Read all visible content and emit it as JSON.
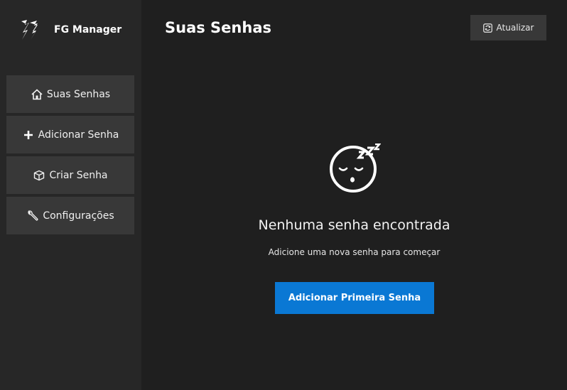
{
  "app": {
    "name": "FG Manager"
  },
  "sidebar": {
    "items": [
      {
        "label": "Suas Senhas",
        "icon": "home-icon"
      },
      {
        "label": "Adicionar Senha",
        "icon": "plus-icon"
      },
      {
        "label": "Criar Senha",
        "icon": "package-icon"
      },
      {
        "label": "Configurações",
        "icon": "wrench-icon"
      }
    ]
  },
  "header": {
    "title": "Suas Senhas",
    "refresh_label": "Atualizar",
    "refresh_icon": "refresh-icon"
  },
  "empty_state": {
    "icon": "sleeping-face-icon",
    "title": "Nenhuma senha encontrada",
    "subtitle": "Adicione uma nova senha para começar",
    "button_label": "Adicionar Primeira Senha"
  },
  "colors": {
    "sidebar_bg": "#272727",
    "main_bg": "#1f1f1f",
    "item_bg": "#383838",
    "accent": "#0a78d4"
  }
}
